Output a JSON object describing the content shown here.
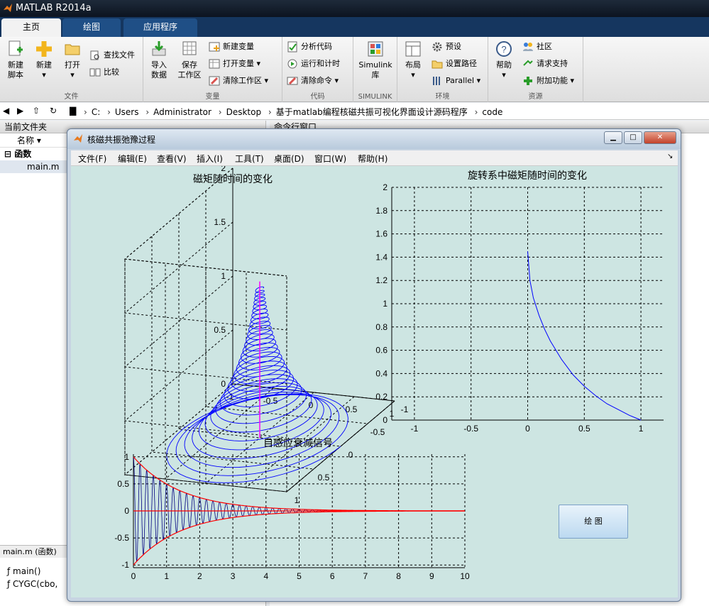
{
  "app": {
    "title": "MATLAB R2014a"
  },
  "tabs": [
    "主页",
    "绘图",
    "应用程序"
  ],
  "ribbon": {
    "file": {
      "group": "文件",
      "new_script": "新建\n脚本",
      "new": "新建",
      "open": "打开",
      "find_files": "查找文件",
      "compare": "比较"
    },
    "variable": {
      "group": "变量",
      "import": "导入\n数据",
      "save_ws": "保存\n工作区",
      "new_var": "新建变量",
      "open_var": "打开变量",
      "clear_ws": "清除工作区"
    },
    "code": {
      "group": "代码",
      "analyze": "分析代码",
      "run_time": "运行和计时",
      "clear_cmd": "清除命令"
    },
    "simulink": {
      "group": "SIMULINK",
      "lib": "Simulink\n库"
    },
    "env": {
      "group": "环境",
      "layout": "布局",
      "prefs": "预设",
      "set_path": "设置路径",
      "parallel": "Parallel"
    },
    "resources": {
      "group": "资源",
      "help": "帮助",
      "community": "社区",
      "support": "请求支持",
      "addons": "附加功能"
    }
  },
  "address": {
    "path": [
      "C:",
      "Users",
      "Administrator",
      "Desktop",
      "基于matlab编程核磁共振可视化界面设计源码程序",
      "code"
    ]
  },
  "current_folder": {
    "title": "当前文件夹",
    "col_name": "名称",
    "group": "函数",
    "file": "main.m",
    "details_title": "main.m (函数)",
    "functions": [
      "main()",
      "CYGC(cbo,"
    ]
  },
  "command_window": {
    "title": "命令行窗口"
  },
  "figure": {
    "title": "核磁共振弛豫过程",
    "menus": [
      "文件(F)",
      "编辑(E)",
      "查看(V)",
      "插入(I)",
      "工具(T)",
      "桌面(D)",
      "窗口(W)",
      "帮助(H)"
    ],
    "button_label": "绘 图"
  },
  "chart_data": [
    {
      "type": "line",
      "title": "磁矩随时间的变化",
      "projection": "3d",
      "x_ticks": [
        -1,
        -0.5,
        0,
        0.5,
        1
      ],
      "y_ticks": [
        -1,
        -0.5,
        0,
        0.5,
        1
      ],
      "z_ticks": [
        0,
        0.5,
        1,
        1.5,
        2
      ],
      "xlim": [
        -1,
        1
      ],
      "ylim": [
        -1,
        1
      ],
      "zlim": [
        0,
        2
      ],
      "grid": true,
      "series": [
        {
          "color": "#0000ff",
          "x": [
            1,
            0.0,
            -0.8,
            0.0,
            0.6,
            0.0,
            -0.4,
            0.0,
            0.2,
            0.0
          ],
          "y": [
            0.0,
            0.9,
            0.0,
            -0.7,
            0.0,
            0.5,
            0.0,
            -0.3,
            0.0,
            0.0
          ],
          "z": [
            0.0,
            0.1,
            0.2,
            0.35,
            0.45,
            0.6,
            0.7,
            0.85,
            1.0,
            1.45
          ]
        },
        {
          "color": "#ff00ff",
          "x": [
            0,
            0
          ],
          "y": [
            0,
            0
          ],
          "z": [
            0,
            1.45
          ]
        }
      ]
    },
    {
      "type": "line",
      "title": "旋转系中磁矩随时间的变化",
      "x_ticks": [
        -1,
        -0.5,
        0,
        0.5,
        1
      ],
      "y_ticks": [
        0,
        0.2,
        0.4,
        0.6,
        0.8,
        1,
        1.2,
        1.4,
        1.6,
        1.8,
        2
      ],
      "xlim": [
        -1.2,
        1.2
      ],
      "ylim": [
        0,
        2
      ],
      "grid": true,
      "series": [
        {
          "color": "#0000ff",
          "x": [
            0,
            0.02,
            0.05,
            0.1,
            0.15,
            0.2,
            0.3,
            0.4,
            0.5,
            0.6,
            0.7,
            0.8,
            0.9,
            1.0
          ],
          "y": [
            1.45,
            1.2,
            1.05,
            0.9,
            0.78,
            0.68,
            0.52,
            0.39,
            0.29,
            0.21,
            0.14,
            0.09,
            0.04,
            0.0
          ]
        }
      ]
    },
    {
      "type": "line",
      "title": "自感应衰减信号",
      "x_ticks": [
        0,
        1,
        2,
        3,
        4,
        5,
        6,
        7,
        8,
        9,
        10
      ],
      "y_ticks": [
        -1,
        -0.5,
        0,
        0.5,
        1
      ],
      "xlim": [
        0,
        10
      ],
      "ylim": [
        -1.05,
        1.05
      ],
      "grid": true,
      "signal": {
        "t_end": 8.3,
        "frequency": 5,
        "decay": 0.7,
        "color": "#000080"
      },
      "envelope": {
        "t_end": 10,
        "decay": 0.7,
        "color": "#ff0000"
      }
    }
  ]
}
